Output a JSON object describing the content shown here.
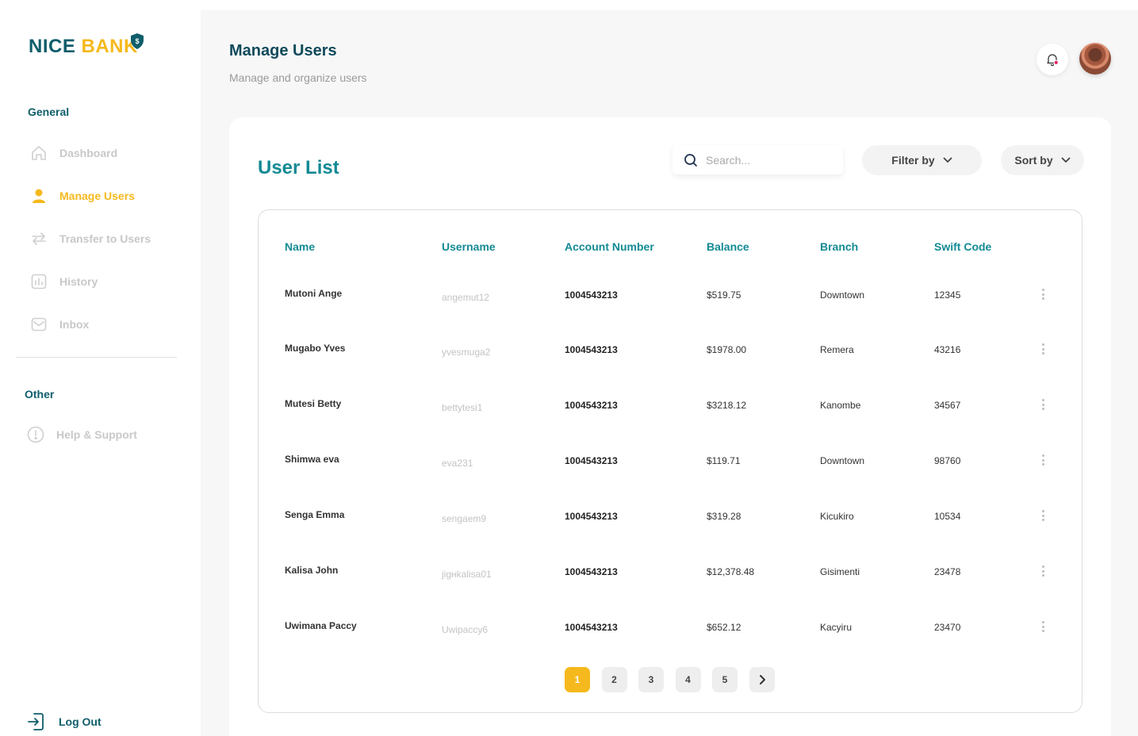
{
  "brand": {
    "part1": "NICE",
    "part2": "BANK"
  },
  "colors": {
    "primary": "#0f5d6b",
    "accent": "#f5b91d",
    "teal": "#138a94",
    "muted": "#c8c8c8"
  },
  "sidebar": {
    "general_label": "General",
    "items": [
      {
        "label": "Dashboard",
        "icon": "home-icon"
      },
      {
        "label": "Manage Users",
        "icon": "user-icon"
      },
      {
        "label": "Transfer to Users",
        "icon": "transfer-icon"
      },
      {
        "label": "History",
        "icon": "history-chart-icon"
      },
      {
        "label": "Inbox",
        "icon": "mail-icon"
      }
    ],
    "other_label": "Other",
    "help_label": "Help & Support",
    "logout_label": "Log Out"
  },
  "header": {
    "title": "Manage Users",
    "subtitle": "Manage and organize users"
  },
  "card": {
    "title": "User List",
    "search_placeholder": "Search...",
    "filter_label": "Filter by",
    "sort_label": "Sort by"
  },
  "table": {
    "headers": [
      "Name",
      "Username",
      "Account Number",
      "Balance",
      "Branch",
      "Swift Code"
    ],
    "rows": [
      {
        "name": "Mutoni Ange",
        "username": "angemut12",
        "account": "1004543213",
        "balance": "$519.75",
        "branch": "Downtown",
        "swift": "12345"
      },
      {
        "name": "Mugabo Yves",
        "username": "yvesmuga2",
        "account": "1004543213",
        "balance": "$1978.00",
        "branch": "Remera",
        "swift": "43216"
      },
      {
        "name": "Mutesi Betty",
        "username": "bettytesi1",
        "account": "1004543213",
        "balance": "$3218.12",
        "branch": "Kanombe",
        "swift": "34567"
      },
      {
        "name": "Shimwa eva",
        "username": "eva231",
        "account": "1004543213",
        "balance": "$119.71",
        "branch": "Downtown",
        "swift": "98760"
      },
      {
        "name": "Senga Emma",
        "username": "sengaem9",
        "account": "1004543213",
        "balance": "$319.28",
        "branch": "Kicukiro",
        "swift": "10534"
      },
      {
        "name": "Kalisa John",
        "username": "jigнkalisa01",
        "account": "1004543213",
        "balance": "$12,378.48",
        "branch": "Gisimenti",
        "swift": "23478"
      },
      {
        "name": "Uwimana Paccy",
        "username": "Uwipaccy6",
        "account": "1004543213",
        "balance": "$652.12",
        "branch": "Kacyiru",
        "swift": "23470"
      }
    ]
  },
  "pagination": {
    "pages": [
      "1",
      "2",
      "3",
      "4",
      "5"
    ],
    "current": "1"
  }
}
